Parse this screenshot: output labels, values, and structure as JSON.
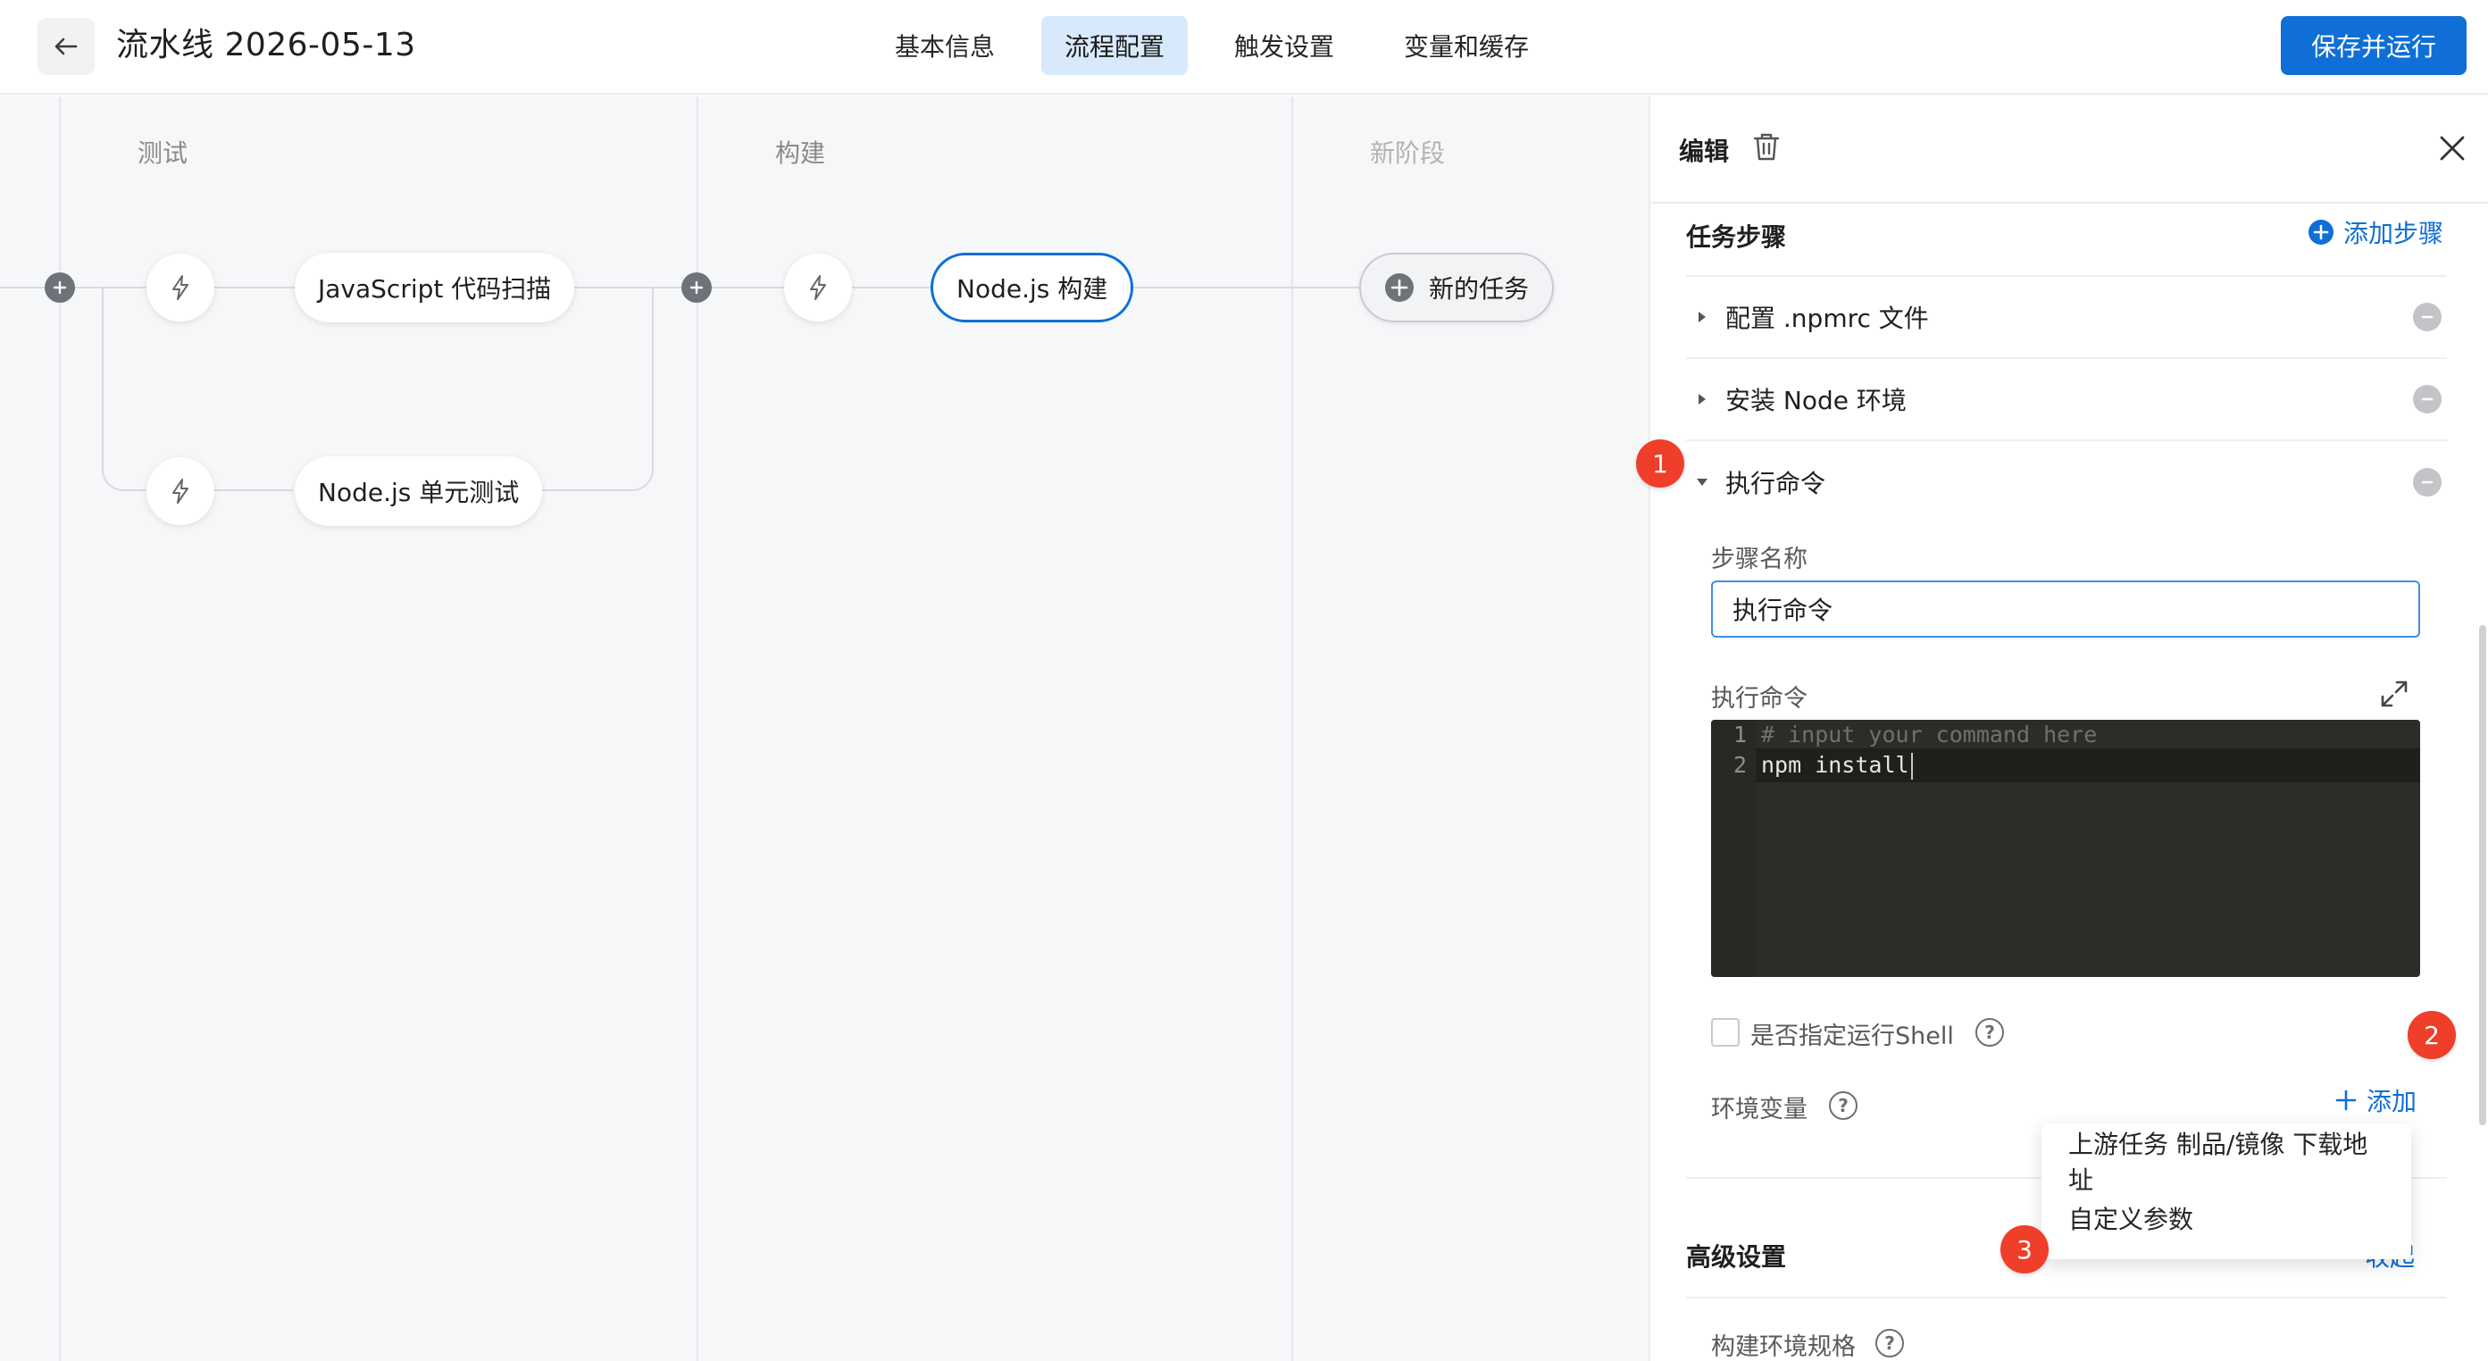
{
  "header": {
    "title": "流水线 2026-05-13",
    "tabs": [
      "基本信息",
      "流程配置",
      "触发设置",
      "变量和缓存"
    ],
    "active_tab": "流程配置",
    "save_run_label": "保存并运行"
  },
  "pipeline": {
    "stages": [
      {
        "name": "测试",
        "jobs": [
          "JavaScript 代码扫描",
          "Node.js 单元测试"
        ]
      },
      {
        "name": "构建",
        "jobs": [
          "Node.js 构建"
        ]
      },
      {
        "name": "新阶段",
        "jobs": [
          "新的任务"
        ]
      }
    ],
    "selected_job": "Node.js 构建"
  },
  "panel": {
    "title": "编辑",
    "task_steps_title": "任务步骤",
    "add_step_label": "添加步骤",
    "steps": [
      {
        "label": "配置 .npmrc 文件",
        "expanded": false
      },
      {
        "label": "安装 Node 环境",
        "expanded": false
      },
      {
        "label": "执行命令",
        "expanded": true
      }
    ],
    "step_name_label": "步骤名称",
    "step_name_value": "执行命令",
    "command_label": "执行命令",
    "command_lines": [
      {
        "num": "1",
        "text": "# input your command here",
        "color": "#6f716a"
      },
      {
        "num": "2",
        "text": "npm install",
        "color": "#e6e6e6"
      }
    ],
    "shell_checkbox_label": "是否指定运行Shell",
    "shell_checked": false,
    "env_label": "环境变量",
    "env_add_label": "添加",
    "advanced_title": "高级设置",
    "advanced_toggle": "收起",
    "build_spec_label": "构建环境规格"
  },
  "dropdown": {
    "items": [
      "上游任务 制品/镜像 下载地址",
      "自定义参数"
    ]
  },
  "annotations": [
    "1",
    "2",
    "3"
  ],
  "colors": {
    "accent": "#0f6fd6",
    "active_tab_bg": "#d7e9fb",
    "badge": "#ef3e2a",
    "editor_bg": "#2b2d28"
  }
}
